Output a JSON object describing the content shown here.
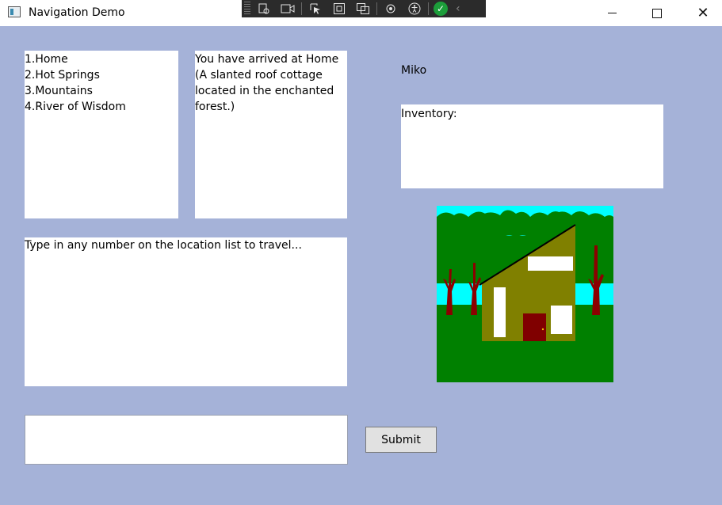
{
  "window": {
    "title": "Navigation Demo",
    "minimize_icon": "minimize-icon",
    "maximize_icon": "maximize-icon",
    "close_glyph": "✕"
  },
  "devtools": {
    "tools": [
      "select-element-icon",
      "record-icon",
      "pointer-icon",
      "frame-icon",
      "layout-icon",
      "hot-reload-icon",
      "accessibility-icon"
    ],
    "status_glyph": "✓",
    "collapse_glyph": "‹"
  },
  "locations": {
    "text": "1.Home\n2.Hot Springs\n3.Mountains\n4.River of Wisdom"
  },
  "description": {
    "text": "You have arrived at Home\n(A slanted roof cottage\nlocated in the enchanted\nforest.)"
  },
  "log": {
    "text": "Type in any number on the location list to travel..."
  },
  "player": {
    "name": "Miko"
  },
  "inventory": {
    "text": "Inventory:"
  },
  "scene": {
    "sky": "#00ffff",
    "grass": "#008000",
    "house": "#808000",
    "door": "#800000",
    "trunk": "#8b0000"
  },
  "command": {
    "value": "",
    "placeholder": ""
  },
  "submit": {
    "label": "Submit"
  }
}
